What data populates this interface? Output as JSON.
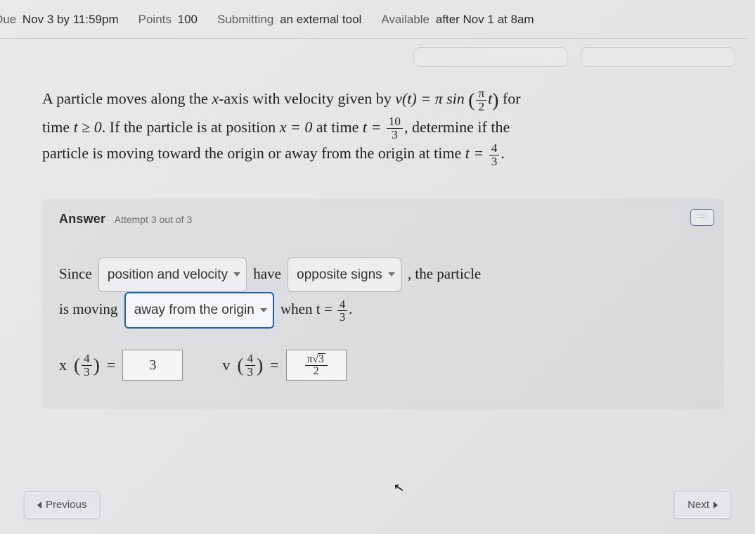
{
  "header": {
    "due_label": "Due",
    "due_value": "Nov 3 by 11:59pm",
    "points_label": "Points",
    "points_value": "100",
    "submitting_label": "Submitting",
    "submitting_value": "an external tool",
    "available_label": "Available",
    "available_value": "after Nov 1 at 8am"
  },
  "problem": {
    "line1_a": "A particle moves along the ",
    "line1_xaxis": "x",
    "line1_b": "-axis with velocity given by ",
    "vt": "v(t) = π sin",
    "arg_num": "π",
    "arg_den": "2",
    "arg_var": "t",
    "line1_c": " for",
    "line2_a": "time ",
    "tgeq": "t ≥ 0",
    "line2_b": ". If the particle is at position ",
    "xeq": "x = 0",
    "line2_c": " at time ",
    "teq": "t =",
    "t0_num": "10",
    "t0_den": "3",
    "line2_d": ", determine if the",
    "line3_a": "particle is moving toward the origin or away from the origin at time ",
    "t1_num": "4",
    "t1_den": "3",
    "period": "."
  },
  "answer": {
    "label": "Answer",
    "attempt": "Attempt 3 out of 3",
    "sentence": {
      "s1": "Since",
      "sel1": "position and velocity",
      "s2": "have",
      "sel2": "opposite signs",
      "s3": ", the particle",
      "s4": "is moving",
      "sel3": "away from the origin",
      "s5": "when",
      "teq": "t =",
      "t_num": "4",
      "t_den": "3",
      "dot": "."
    },
    "eq": {
      "x_lhs_var": "x",
      "arg_num": "4",
      "arg_den": "3",
      "equals": "=",
      "x_value": "3",
      "v_lhs_var": "v",
      "v_value_pi": "π",
      "v_value_root": "3",
      "v_value_den": "2"
    }
  },
  "nav": {
    "prev": "Previous",
    "next": "Next"
  }
}
